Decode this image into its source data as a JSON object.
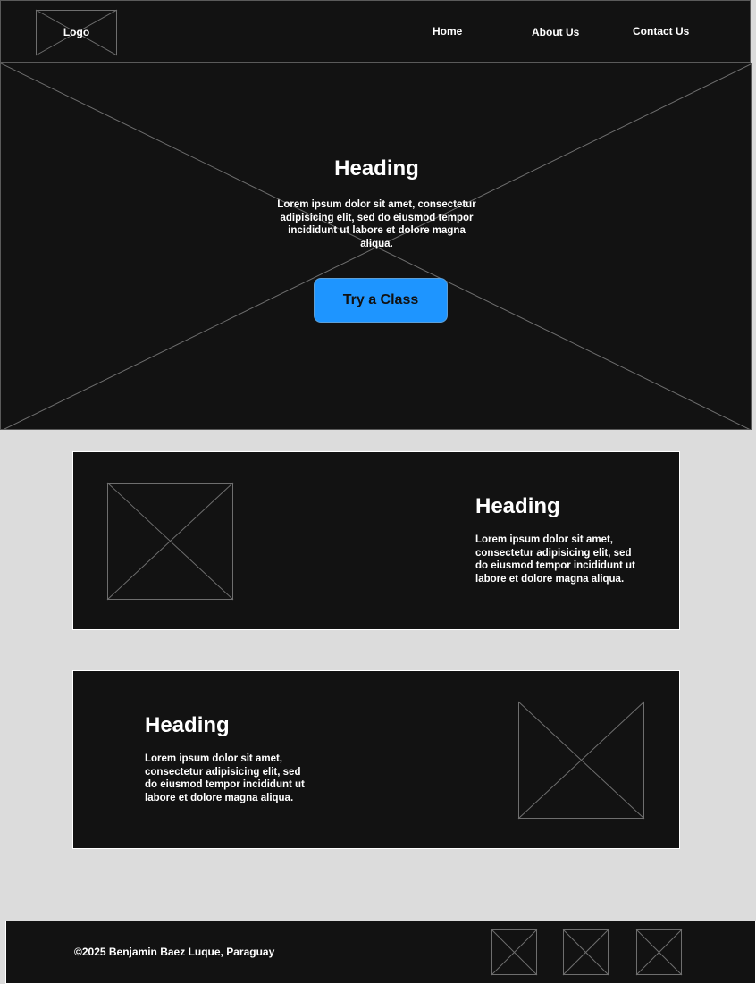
{
  "header": {
    "logo_label": "Logo",
    "nav": {
      "home": "Home",
      "about": "About Us",
      "contact": "Contact Us"
    }
  },
  "hero": {
    "title": "Heading",
    "text": "Lorem ipsum dolor sit amet, consectetur adipisicing elit, sed do eiusmod tempor incididunt ut labore et dolore magna aliqua.",
    "cta_label": "Try a Class"
  },
  "features": [
    {
      "title": "Heading",
      "text": "Lorem ipsum dolor sit amet, consectetur adipisicing elit, sed do eiusmod tempor incididunt ut labore et dolore magna aliqua."
    },
    {
      "title": "Heading",
      "text": "Lorem ipsum dolor sit amet, consectetur adipisicing elit, sed do eiusmod tempor incididunt ut labore et dolore magna aliqua."
    }
  ],
  "footer": {
    "copyright": "©2025 Benjamin Baez Luque, Paraguay",
    "social_icons": [
      "image-placeholder-icon",
      "image-placeholder-icon",
      "image-placeholder-icon"
    ]
  },
  "colors": {
    "page_background": "#dcdcdc",
    "panel_background": "#121212",
    "accent": "#1e95ff",
    "placeholder_line": "#6e6e6e",
    "text": "#ffffff"
  }
}
